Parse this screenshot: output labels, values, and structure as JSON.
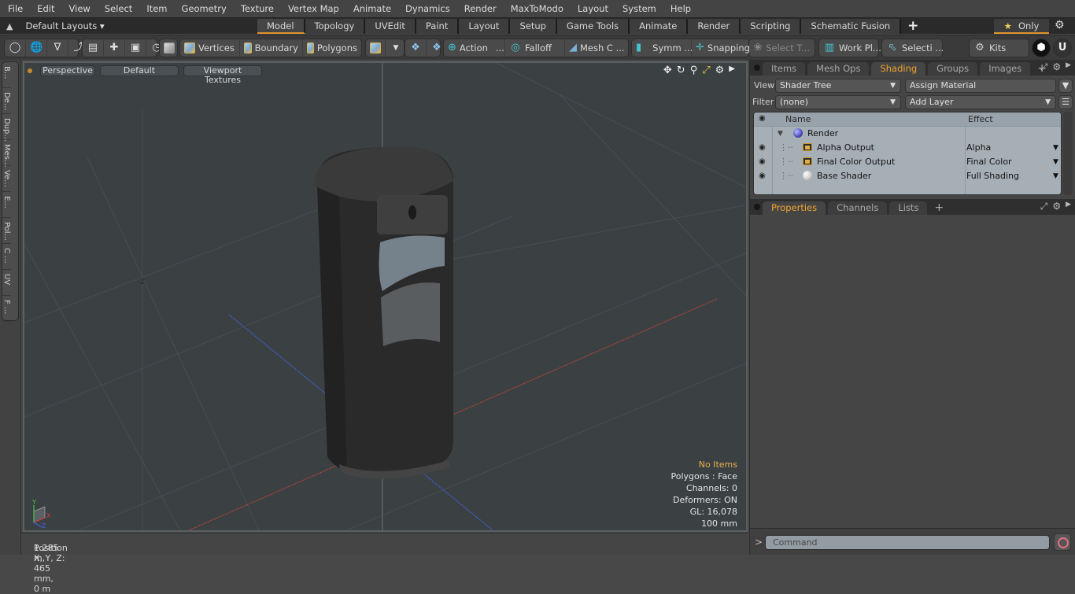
{
  "menu": [
    "File",
    "Edit",
    "View",
    "Select",
    "Item",
    "Geometry",
    "Texture",
    "Vertex Map",
    "Animate",
    "Dynamics",
    "Render",
    "MaxToModo",
    "Layout",
    "System",
    "Help"
  ],
  "layouts": {
    "label": "Default Layouts ▾",
    "tabs": [
      "Model",
      "Topology",
      "UVEdit",
      "Paint",
      "Layout",
      "Setup",
      "Game Tools",
      "Animate",
      "Render",
      "Scripting",
      "Schematic Fusion"
    ],
    "active_tab": "Model",
    "add_label": "+",
    "only_label": "Only",
    "star_glyph": "★",
    "settings_glyph": "⚙"
  },
  "toolbar": {
    "selection_modes": [
      "Vertices",
      "Boundary",
      "Polygons"
    ],
    "action_label": "Action",
    "action_ellipsis": "...",
    "falloff_label": "Falloff",
    "mesh_label": "Mesh C ...",
    "symm_label": "Symm ...",
    "snapping_label": "Snapping",
    "select_t_label": "Select T...",
    "work_plane_label": "Work Pl...",
    "selection_label": "Selecti ...",
    "kits_label": "Kits"
  },
  "left_tabs": [
    "B...",
    "De...",
    "Dup...",
    "Mes...",
    "Ve...",
    "E...",
    "Pol...",
    "C ...",
    "UV",
    "F ..."
  ],
  "viewport": {
    "view_mode": "Perspective",
    "shading_mode": "Default",
    "texture_mode": "Viewport Textures",
    "axis_label": "-Z",
    "info": {
      "selection": "No Items",
      "polygons": "Polygons : Face",
      "channels": "Channels: 0",
      "deformers": "Deformers: ON",
      "gl": "GL: 16,078",
      "grid": "100 mm"
    },
    "gizmo": {
      "x": "X",
      "y": "Y",
      "z": "Z"
    },
    "colors": {
      "x_axis": "#c0453c",
      "z_axis": "#3f5fd0",
      "bg": "#3b4043"
    }
  },
  "status": {
    "position_label": "Position X, Y, Z:",
    "position_value": "1.285 m, 465 mm, 0 m"
  },
  "right_panel": {
    "top_tabs": [
      "Items",
      "Mesh Ops",
      "Shading",
      "Groups",
      "Images"
    ],
    "top_active": "Shading",
    "view_label": "View",
    "view_value": "Shader Tree",
    "assign_material": "Assign Material",
    "filter_label": "Filter",
    "filter_value": "(none)",
    "add_layer": "Add Layer",
    "tree": {
      "headers": {
        "name": "Name",
        "effect": "Effect"
      },
      "rows": [
        {
          "name": "Render",
          "effect": "",
          "icon": "render-sphere",
          "visible": false
        },
        {
          "name": "Alpha Output",
          "effect": "Alpha",
          "icon": "image-output",
          "visible": true
        },
        {
          "name": "Final Color Output",
          "effect": "Final Color",
          "icon": "image-output",
          "visible": true
        },
        {
          "name": "Base Shader",
          "effect": "Full Shading",
          "icon": "shader-sphere",
          "visible": true
        }
      ]
    },
    "bottom_tabs": [
      "Properties",
      "Channels",
      "Lists"
    ],
    "bottom_active": "Properties",
    "command_placeholder": "Command",
    "command_prompt": ">"
  }
}
